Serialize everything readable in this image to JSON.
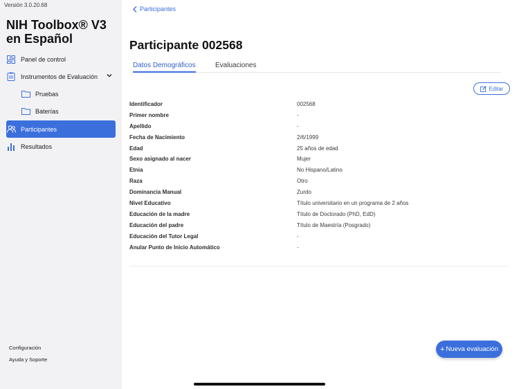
{
  "sidebar": {
    "version": "Versión 3.0.20.68",
    "app_title": "NIH Toolbox® V3 en Español",
    "items": [
      {
        "label": "Panel de control",
        "icon": "dashboard-icon"
      },
      {
        "label": "Instrumentos de Evaluación",
        "icon": "clipboard-icon",
        "expanded": true
      },
      {
        "label": "Pruebas",
        "icon": "folder-icon"
      },
      {
        "label": "Baterías",
        "icon": "folder-icon"
      },
      {
        "label": "Participantes",
        "icon": "users-icon",
        "active": true
      },
      {
        "label": "Resultados",
        "icon": "bar-chart-icon"
      }
    ],
    "footer": {
      "settings": "Configuración",
      "help": "Ayuda y Soporte"
    }
  },
  "main": {
    "back_label": "Participantes",
    "title": "Participante 002568",
    "tabs": [
      {
        "label": "Datos Demográficos",
        "active": true
      },
      {
        "label": "Evaluaciones",
        "active": false
      }
    ],
    "edit_label": "Editar",
    "fields": [
      {
        "label": "Identificador",
        "value": "002568"
      },
      {
        "label": "Primer nombre",
        "value": "-"
      },
      {
        "label": "Apellido",
        "value": "-"
      },
      {
        "label": "Fecha de Nacimiento",
        "value": "2/6/1999"
      },
      {
        "label": "Edad",
        "value": "25 años de edad"
      },
      {
        "label": "Sexo asignado al nacer",
        "value": "Mujer"
      },
      {
        "label": "Etnia",
        "value": "No Hispano/Latino"
      },
      {
        "label": "Raza",
        "value": "Otro"
      },
      {
        "label": "Dominancia Manual",
        "value": "Zurdo"
      },
      {
        "label": "Nivel Educativo",
        "value": "Título universitario en un programa de 2 años"
      },
      {
        "label": "Educación de la madre",
        "value": "Título de Doctorado (PhD, EdD)"
      },
      {
        "label": "Educación del padre",
        "value": "Título de Maestría (Posgrado)"
      },
      {
        "label": "Educación del Tutor Legal",
        "value": "-"
      },
      {
        "label": "Anular Punto de Inicio Automático",
        "value": "-"
      }
    ],
    "fab_label": "Nueva evaluación"
  },
  "colors": {
    "accent": "#3b6fdc",
    "sidebar_bg": "#f2f2f4"
  }
}
